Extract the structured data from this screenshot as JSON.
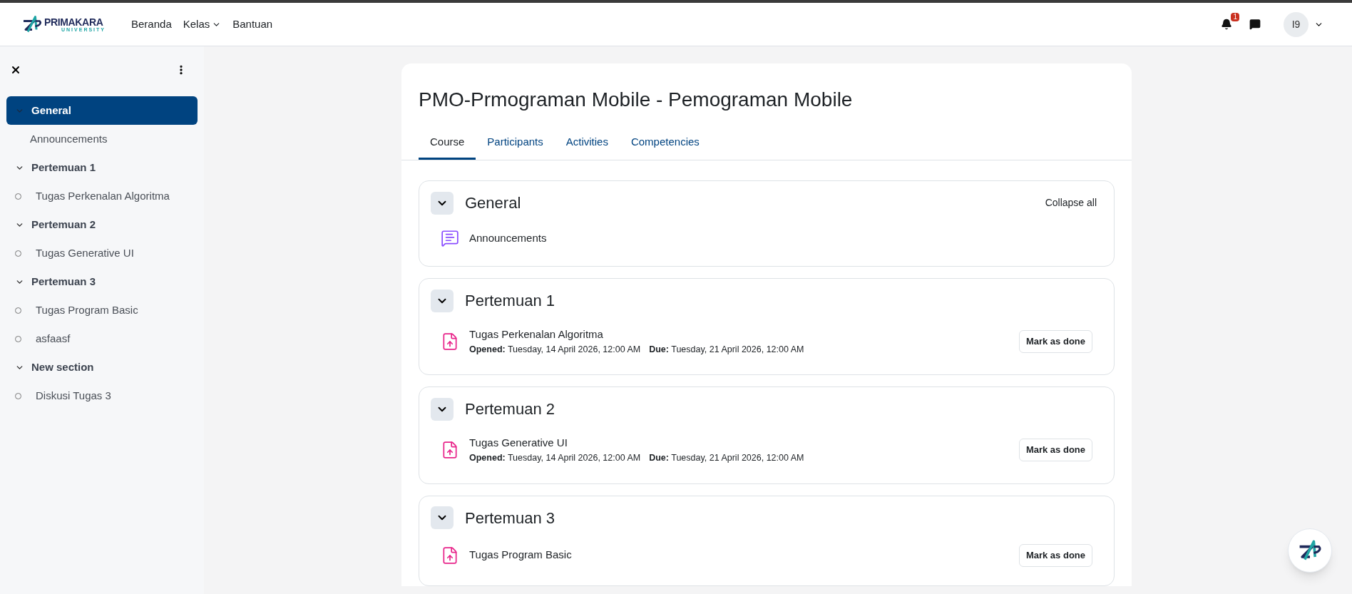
{
  "brand": {
    "name": "PRIMAKARA",
    "sub": "UNIVERSITY"
  },
  "nav": [
    {
      "label": "Beranda",
      "dropdown": false
    },
    {
      "label": "Kelas",
      "dropdown": true
    },
    {
      "label": "Bantuan",
      "dropdown": false
    }
  ],
  "notifications": {
    "count": "1"
  },
  "user": {
    "initials": "I9"
  },
  "sidebar": {
    "items": [
      {
        "label": "General",
        "kind": "section",
        "selected": true,
        "expanded": true,
        "children": [
          {
            "label": "Announcements",
            "kind": "activity",
            "selected": false
          }
        ]
      },
      {
        "label": "Pertemuan 1",
        "kind": "section",
        "selected": false,
        "expanded": true,
        "children": [
          {
            "label": "Tugas Perkenalan Algoritma",
            "kind": "activity",
            "selected": false
          }
        ]
      },
      {
        "label": "Pertemuan 2",
        "kind": "section",
        "selected": false,
        "expanded": true,
        "children": [
          {
            "label": "Tugas Generative UI",
            "kind": "activity",
            "selected": false
          }
        ]
      },
      {
        "label": "Pertemuan 3",
        "kind": "section",
        "selected": false,
        "expanded": true,
        "children": [
          {
            "label": "Tugas Program Basic",
            "kind": "activity",
            "selected": false
          },
          {
            "label": "asfaasf",
            "kind": "activity",
            "selected": false
          }
        ]
      },
      {
        "label": "New section",
        "kind": "section",
        "selected": false,
        "expanded": true,
        "children": [
          {
            "label": "Diskusi Tugas 3",
            "kind": "activity",
            "selected": false
          }
        ]
      }
    ]
  },
  "course": {
    "title": "PMO-Prmograman Mobile - Pemograman Mobile",
    "tabs": [
      {
        "label": "Course",
        "selected": true
      },
      {
        "label": "Participants",
        "selected": false
      },
      {
        "label": "Activities",
        "selected": false
      },
      {
        "label": "Competencies",
        "selected": false
      }
    ],
    "collapse_all": "Collapse all",
    "sections": [
      {
        "title": "General",
        "expanded": true,
        "activities": [
          {
            "kind": "forum",
            "name": "Announcements"
          }
        ]
      },
      {
        "title": "Pertemuan 1",
        "expanded": true,
        "activities": [
          {
            "kind": "assignment",
            "name": "Tugas Perkenalan Algoritma",
            "dates": [
              "**Opened:** Tuesday, 14 April 2026, 12:00 AM",
              "**Due:** Tuesday, 21 April 2026, 12:00 AM"
            ],
            "button": "Mark as done"
          }
        ]
      },
      {
        "title": "Pertemuan 2",
        "expanded": true,
        "activities": [
          {
            "kind": "assignment",
            "name": "Tugas Generative UI",
            "dates": [
              "**Opened:** Tuesday, 14 April 2026, 12:00 AM",
              "**Due:** Tuesday, 21 April 2026, 12:00 AM"
            ],
            "button": "Mark as done"
          }
        ]
      },
      {
        "title": "Pertemuan 3",
        "expanded": true,
        "activities": [
          {
            "kind": "assignment",
            "name": "Tugas Program Basic",
            "button": "Mark as done"
          }
        ]
      }
    ]
  }
}
